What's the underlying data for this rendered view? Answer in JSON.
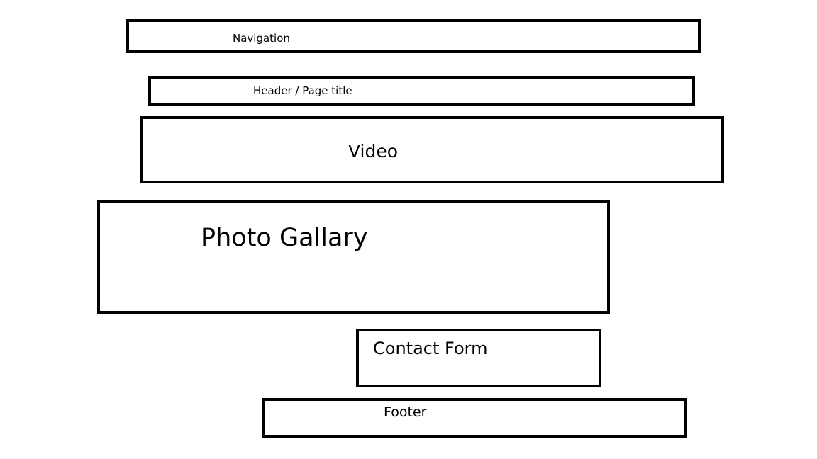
{
  "wireframe": {
    "navigation": {
      "label": "Navigation"
    },
    "header": {
      "label": "Header / Page title"
    },
    "video": {
      "label": "Video"
    },
    "photo_gallery": {
      "label": "Photo Gallary"
    },
    "contact_form": {
      "label": "Contact Form"
    },
    "footer": {
      "label": "Footer"
    }
  },
  "colors": {
    "stroke": "#000000",
    "background": "#ffffff"
  }
}
